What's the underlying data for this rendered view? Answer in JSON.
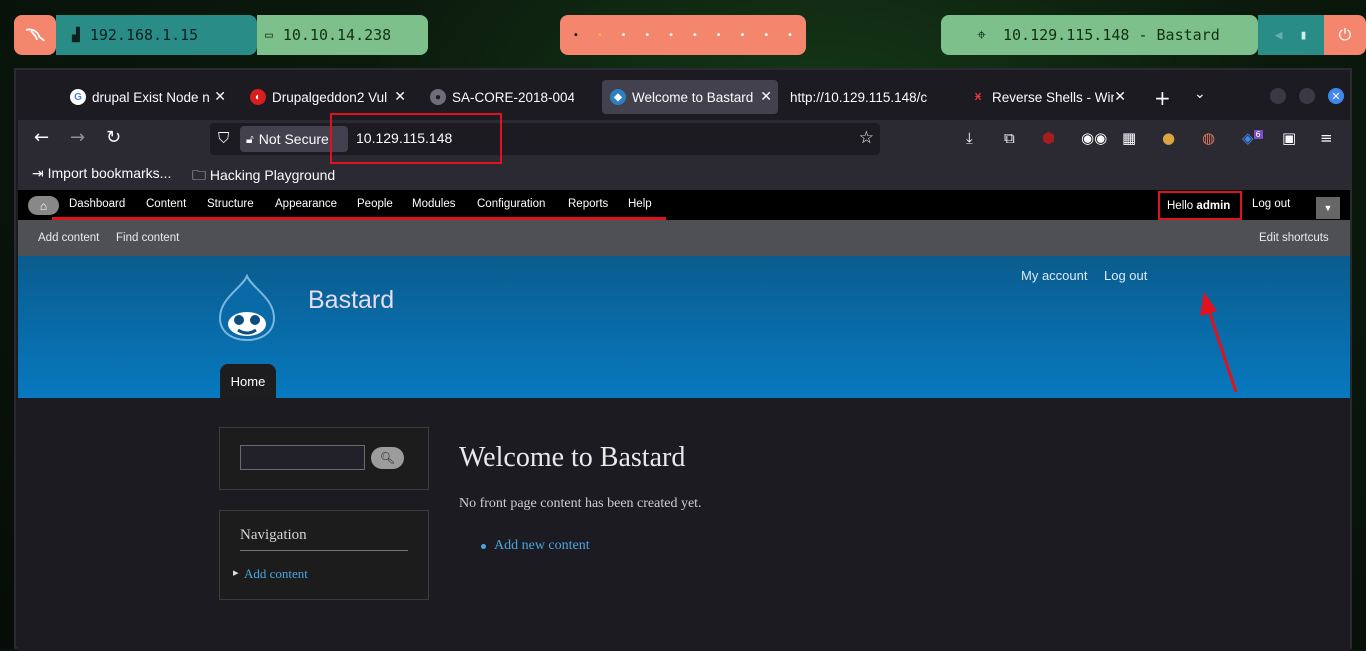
{
  "panel": {
    "kali_icon": "kali-dragon-icon",
    "local_ip": "192.168.1.15",
    "vpn_ip": "10.10.14.238",
    "workspaces": [
      "•",
      "•",
      "•",
      "•",
      "•",
      "•",
      "•",
      "•",
      "•",
      "•"
    ],
    "target": "10.129.115.148 - Bastard"
  },
  "browser": {
    "tabs": [
      {
        "label": "drupal Exist Node n",
        "icon": "google-icon"
      },
      {
        "label": "Drupalgeddon2 Vul",
        "icon": "drupalgeddon-icon"
      },
      {
        "label": "SA-CORE-2018-004/",
        "icon": "github-icon"
      },
      {
        "label": "Welcome to Bastard",
        "icon": "drupal-icon"
      },
      {
        "label": "http://10.129.115.148/c",
        "icon": ""
      },
      {
        "label": "Reverse Shells - Win",
        "icon": "hacktricks-icon"
      }
    ],
    "not_secure": "Not Secure",
    "url": "10.129.115.148",
    "bookmarks": {
      "import": "Import bookmarks...",
      "folder": "Hacking Playground"
    },
    "badge_count": "6"
  },
  "toolbar": {
    "menu": [
      "Dashboard",
      "Content",
      "Structure",
      "Appearance",
      "People",
      "Modules",
      "Configuration",
      "Reports",
      "Help"
    ],
    "hello": "Hello",
    "user": "admin",
    "logout": "Log out"
  },
  "shortcuts": {
    "add_content": "Add content",
    "find_content": "Find content",
    "edit": "Edit shortcuts"
  },
  "site": {
    "name": "Bastard",
    "my_account": "My account",
    "logout": "Log out",
    "home_tab": "Home"
  },
  "sidebar": {
    "nav_title": "Navigation",
    "nav_link": "Add content"
  },
  "main": {
    "title": "Welcome to Bastard",
    "message": "No front page content has been created yet.",
    "add_new": "Add new content"
  },
  "colors": {
    "highlight": "#e0121e",
    "header": "#0779bf",
    "link": "#4aa6e0"
  }
}
